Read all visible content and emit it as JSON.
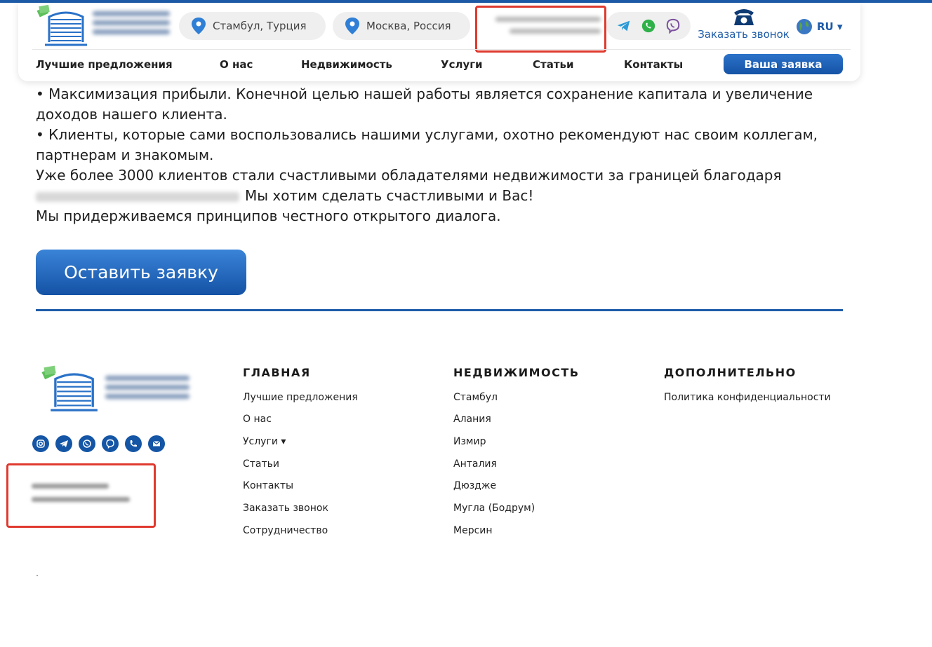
{
  "header": {
    "locations": [
      "Стамбул, Турция",
      "Москва, Россия"
    ],
    "callback_label": "Заказать звонок",
    "language": "RU ▾",
    "nav": [
      "Лучшие предложения",
      "О нас",
      "Недвижимость",
      "Услуги",
      "Статьи",
      "Контакты"
    ],
    "cta": "Ваша заявка"
  },
  "content": {
    "bullet1": "•  Максимизация прибыли. Конечной целью нашей работы является сохранение капитала и увеличение доходов нашего клиента.",
    "bullet2": "•  Клиенты, которые сами воспользовались нашими услугами, охотно рекомендуют нас своим коллегам, партнерам и знакомым.",
    "line3": "Уже более 3000 клиентов стали счастливыми обладателями недвижимости за границей благодаря",
    "line4": "Мы хотим сделать счастливыми и Вас!",
    "line5": "Мы придерживаемся принципов честного открытого диалога.",
    "button": "Оставить заявку"
  },
  "footer": {
    "columns": [
      {
        "title": "ГЛАВНАЯ",
        "links": [
          "Лучшие предложения",
          "О нас",
          "Услуги ▾",
          "Статьи",
          "Контакты",
          "Заказать звонок",
          "Сотрудничество"
        ]
      },
      {
        "title": "НЕДВИЖИМОСТЬ",
        "links": [
          "Стамбул",
          "Алания",
          "Измир",
          "Анталия",
          "Дюздже",
          "Мугла (Бодрум)",
          "Мерсин"
        ]
      },
      {
        "title": "ДОПОЛНИТЕЛЬНО",
        "links": [
          "Политика конфиденциальности"
        ]
      }
    ]
  },
  "colors": {
    "brand": "#1d5ba8",
    "highlight": "#e03a2f"
  }
}
